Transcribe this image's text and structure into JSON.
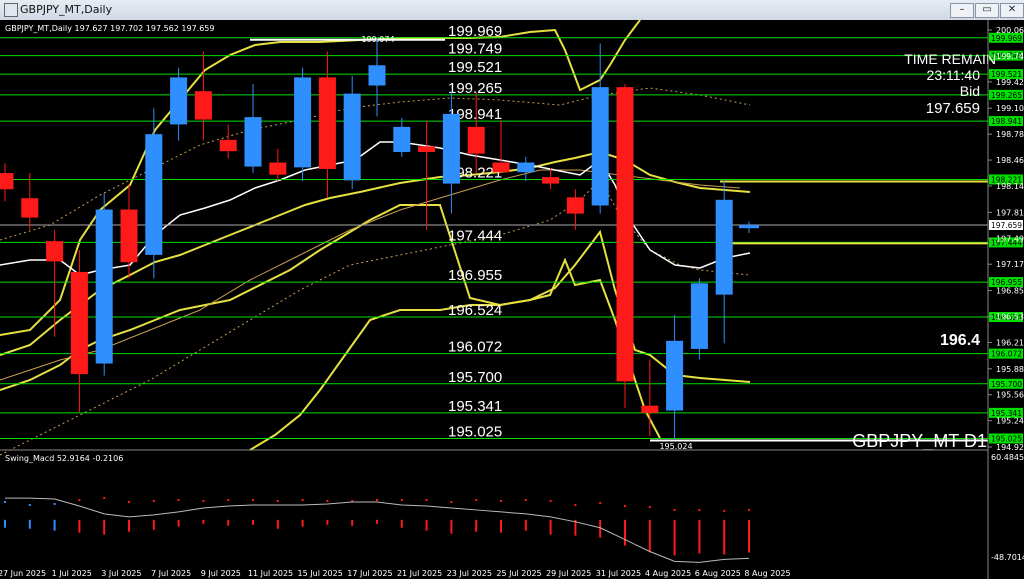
{
  "window": {
    "title": "GBPJPY_MT,Daily",
    "min_label": "–",
    "max_label": "▭",
    "close_label": "✕"
  },
  "chart_info": "GBPJPY_MT,Daily  197.627 197.702 197.562 197.659",
  "watermark": "GBPJPY_MT D1",
  "side_cut_label": "196.4",
  "info_panel": {
    "time_label": "TIME REMAIN",
    "time_value": "23:11:40",
    "bid_label": "Bid",
    "bid_value": "197.659"
  },
  "hi_annot": "199.974",
  "lo_annot": "195.024",
  "indicator_label": "Swing_Macd  52.9164  -0.2106",
  "ind_scale": {
    "top": "60.4845",
    "bottom": "-48.7014"
  },
  "levels": [
    "199.969",
    "199.749",
    "199.521",
    "199.265",
    "198.941",
    "198.221",
    "197.444",
    "196.955",
    "196.524",
    "196.072",
    "195.700",
    "195.341",
    "195.025"
  ],
  "level_tags": [
    "199.969",
    "199.749",
    "199.521",
    "199.265",
    "198.941",
    "198.221",
    "197.444",
    "196.955",
    "196.524",
    "196.072",
    "195.700",
    "195.341",
    "195.025"
  ],
  "price_ticks": [
    "200.065",
    "199.745",
    "199.425",
    "199.100",
    "198.780",
    "198.460",
    "198.140",
    "197.815",
    "197.495",
    "197.175",
    "196.850",
    "196.530",
    "196.210",
    "195.885",
    "195.565",
    "195.245",
    "194.920"
  ],
  "current_price_tag": "197.659",
  "time_labels": [
    "27 Jun 2025",
    "1 Jul 2025",
    "3 Jul 2025",
    "7 Jul 2025",
    "9 Jul 2025",
    "11 Jul 2025",
    "15 Jul 2025",
    "17 Jul 2025",
    "21 Jul 2025",
    "23 Jul 2025",
    "25 Jul 2025",
    "29 Jul 2025",
    "31 Jul 2025",
    "4 Aug 2025",
    "6 Aug 2025",
    "8 Aug 2025"
  ],
  "colors": {
    "bull": "#2f8fff",
    "bear": "#ff1a1a",
    "level": "#00e000",
    "band": "#e6e040",
    "ma_white": "#ffffff"
  },
  "chart_data": {
    "type": "candlestick",
    "candles": [
      {
        "o": 198.3,
        "h": 198.42,
        "l": 197.95,
        "c": 198.1
      },
      {
        "o": 197.99,
        "h": 198.3,
        "l": 197.6,
        "c": 197.75
      },
      {
        "o": 197.46,
        "h": 197.6,
        "l": 196.28,
        "c": 197.21
      },
      {
        "o": 197.08,
        "h": 197.35,
        "l": 195.35,
        "c": 195.82
      },
      {
        "o": 195.95,
        "h": 198.05,
        "l": 195.8,
        "c": 197.85
      },
      {
        "o": 197.85,
        "h": 198.15,
        "l": 197.0,
        "c": 197.2
      },
      {
        "o": 197.29,
        "h": 199.1,
        "l": 197.0,
        "c": 198.78
      },
      {
        "o": 198.9,
        "h": 199.6,
        "l": 198.7,
        "c": 199.48
      },
      {
        "o": 199.31,
        "h": 199.8,
        "l": 198.7,
        "c": 198.96
      },
      {
        "o": 198.71,
        "h": 198.9,
        "l": 198.48,
        "c": 198.57
      },
      {
        "o": 198.38,
        "h": 199.4,
        "l": 198.3,
        "c": 198.99
      },
      {
        "o": 198.43,
        "h": 198.6,
        "l": 198.2,
        "c": 198.28
      },
      {
        "o": 198.37,
        "h": 199.6,
        "l": 198.2,
        "c": 199.48
      },
      {
        "o": 199.48,
        "h": 199.8,
        "l": 198.0,
        "c": 198.35
      },
      {
        "o": 198.21,
        "h": 199.5,
        "l": 198.1,
        "c": 199.28
      },
      {
        "o": 199.38,
        "h": 199.97,
        "l": 199.0,
        "c": 199.63
      },
      {
        "o": 198.56,
        "h": 198.98,
        "l": 198.5,
        "c": 198.87
      },
      {
        "o": 198.63,
        "h": 198.95,
        "l": 197.6,
        "c": 198.56
      },
      {
        "o": 198.17,
        "h": 199.3,
        "l": 197.8,
        "c": 199.03
      },
      {
        "o": 198.87,
        "h": 199.3,
        "l": 198.3,
        "c": 198.54
      },
      {
        "o": 198.43,
        "h": 198.95,
        "l": 198.3,
        "c": 198.31
      },
      {
        "o": 198.31,
        "h": 198.5,
        "l": 198.2,
        "c": 198.43
      },
      {
        "o": 198.25,
        "h": 198.36,
        "l": 198.1,
        "c": 198.17
      },
      {
        "o": 198.0,
        "h": 198.1,
        "l": 197.6,
        "c": 197.8
      },
      {
        "o": 197.9,
        "h": 199.9,
        "l": 197.8,
        "c": 199.36
      },
      {
        "o": 199.36,
        "h": 199.4,
        "l": 195.4,
        "c": 195.73
      },
      {
        "o": 195.43,
        "h": 196.0,
        "l": 195.05,
        "c": 195.34
      },
      {
        "o": 195.37,
        "h": 196.55,
        "l": 195.02,
        "c": 196.23
      },
      {
        "o": 196.13,
        "h": 197.0,
        "l": 196.0,
        "c": 196.94
      },
      {
        "o": 196.8,
        "h": 198.2,
        "l": 196.2,
        "c": 197.97
      },
      {
        "o": 197.62,
        "h": 197.7,
        "l": 197.56,
        "c": 197.66
      }
    ],
    "price_range": [
      194.92,
      200.065
    ],
    "macd_range": [
      -48.7014,
      60.4845
    ],
    "macd_hist": [
      -8,
      -9,
      -11,
      -13,
      -15,
      -12,
      -10,
      -7,
      -4,
      -6,
      -5,
      -9,
      -7,
      -5,
      -6,
      -4,
      -8,
      -11,
      -14,
      -12,
      -13,
      -11,
      -15,
      -16,
      -18,
      -26,
      -33,
      -36,
      -34,
      -35,
      -33
    ],
    "macd_dots": [
      18,
      15,
      16,
      20,
      22,
      18,
      19,
      20,
      19,
      20,
      20,
      19,
      20,
      19,
      19,
      20,
      20,
      20,
      18,
      20,
      19,
      20,
      19,
      15,
      17,
      14,
      13,
      10,
      10,
      9,
      10
    ],
    "macd_line": [
      22,
      22,
      21,
      14,
      6,
      3,
      5,
      8,
      12,
      14,
      15,
      15,
      15,
      16,
      18,
      18,
      15,
      14,
      12,
      10,
      8,
      6,
      3,
      -2,
      -8,
      -20,
      -32,
      -42,
      -43,
      -40,
      -39
    ]
  }
}
